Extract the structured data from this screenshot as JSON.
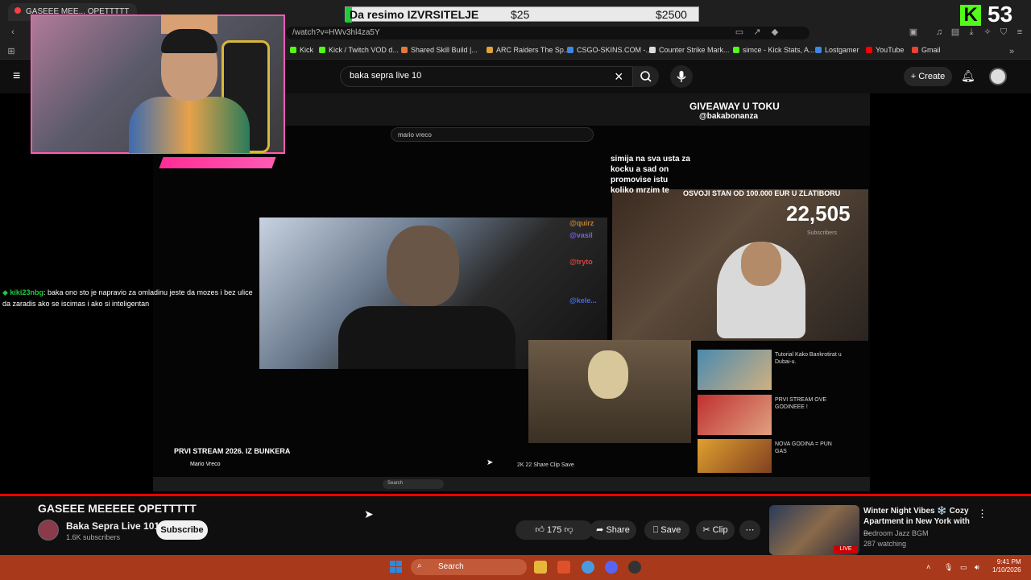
{
  "browser": {
    "active_tab": "GASEEE MEE... OPETTTTT",
    "url": "/watch?v=HWv3hl4za5Y",
    "bookmarks": [
      {
        "label": "Kick",
        "color": "#53fc18"
      },
      {
        "label": "Kick / Twitch VOD d...",
        "color": "#53fc18"
      },
      {
        "label": "Shared Skill Build |...",
        "color": "#e07a3a"
      },
      {
        "label": "ARC Raiders The Sp...",
        "color": "#e0a23a"
      },
      {
        "label": "CSGO-SKINS.COM -...",
        "color": "#3a8ae0"
      },
      {
        "label": "Counter Strike Mark...",
        "color": "#dddddd"
      },
      {
        "label": "simce - Kick Stats, A...",
        "color": "#53fc18"
      },
      {
        "label": "Lostgamer",
        "color": "#3a8ae0"
      },
      {
        "label": "YouTube",
        "color": "#ff0000"
      },
      {
        "label": "Gmail",
        "color": "#ea4335"
      }
    ]
  },
  "overlay": {
    "bonus_title": "Da resimo IZVRSITELJE",
    "bonus_amount": "$25",
    "bonus_target": "$2500",
    "kick_letter": "K",
    "counter": "53"
  },
  "youtube": {
    "search_query": "baka sepra live 10",
    "create_label": "Create"
  },
  "stream": {
    "inner_search": "mario vreco",
    "overlay_text": "simija na sva usta za kocku a sad on promovise istu koliko mrzim te",
    "giveaway": "GIVEAWAY U TOKU",
    "handle": "@bakabonanza",
    "stan_text": "OSVOJI STAN OD 100.000 EUR U ZLATIBORU",
    "subs_count": "22,505",
    "subs_label": "Subscribers",
    "inner_title": "PRVI STREAM 2026. IZ BUNKERA",
    "inner_channel": "Mario Vreco",
    "inner_actions": "2K  22  Share  Clip  Save",
    "inner_taskbar_search": "Search",
    "inner_chat": [
      "@quirz",
      "@vasil",
      "@tryto",
      "@kele..."
    ],
    "recs": [
      {
        "text": "Tutorial Kako Bankrotirat u Dubai-u."
      },
      {
        "text": "PRVI STREAM OVE GODINEEE !"
      },
      {
        "text": "NOVA GODINA = PUN GAS"
      }
    ],
    "chat_user": "kiki23nbg",
    "chat_message": ": baka ono sto je napravio za omladinu jeste da mozes i bez ulice da zaradis ako se iscimas i ako si inteligentan"
  },
  "video": {
    "title": "GASEEE MEEEEE OPETTTTT",
    "channel_name": "Baka Sepra Live 101",
    "channel_subs": "1.6K subscribers",
    "subscribe_label": "Subscribe",
    "likes": "175",
    "share_label": "Share",
    "save_label": "Save",
    "clip_label": "Clip"
  },
  "recommendation": {
    "title": "Winter Night Vibes ❄️ Cozy Apartment in New York with ...",
    "channel": "Bedroom Jazz BGM",
    "viewers": "287 watching",
    "live_badge": "LIVE"
  },
  "taskbar": {
    "search_label": "Search",
    "time": "9:41 PM",
    "date": "1/10/2026"
  },
  "colors": {
    "accent": "#ff0000",
    "kick_green": "#53fc18",
    "taskbar": "#a8391a",
    "webcam_border": "#ff5ab4"
  }
}
